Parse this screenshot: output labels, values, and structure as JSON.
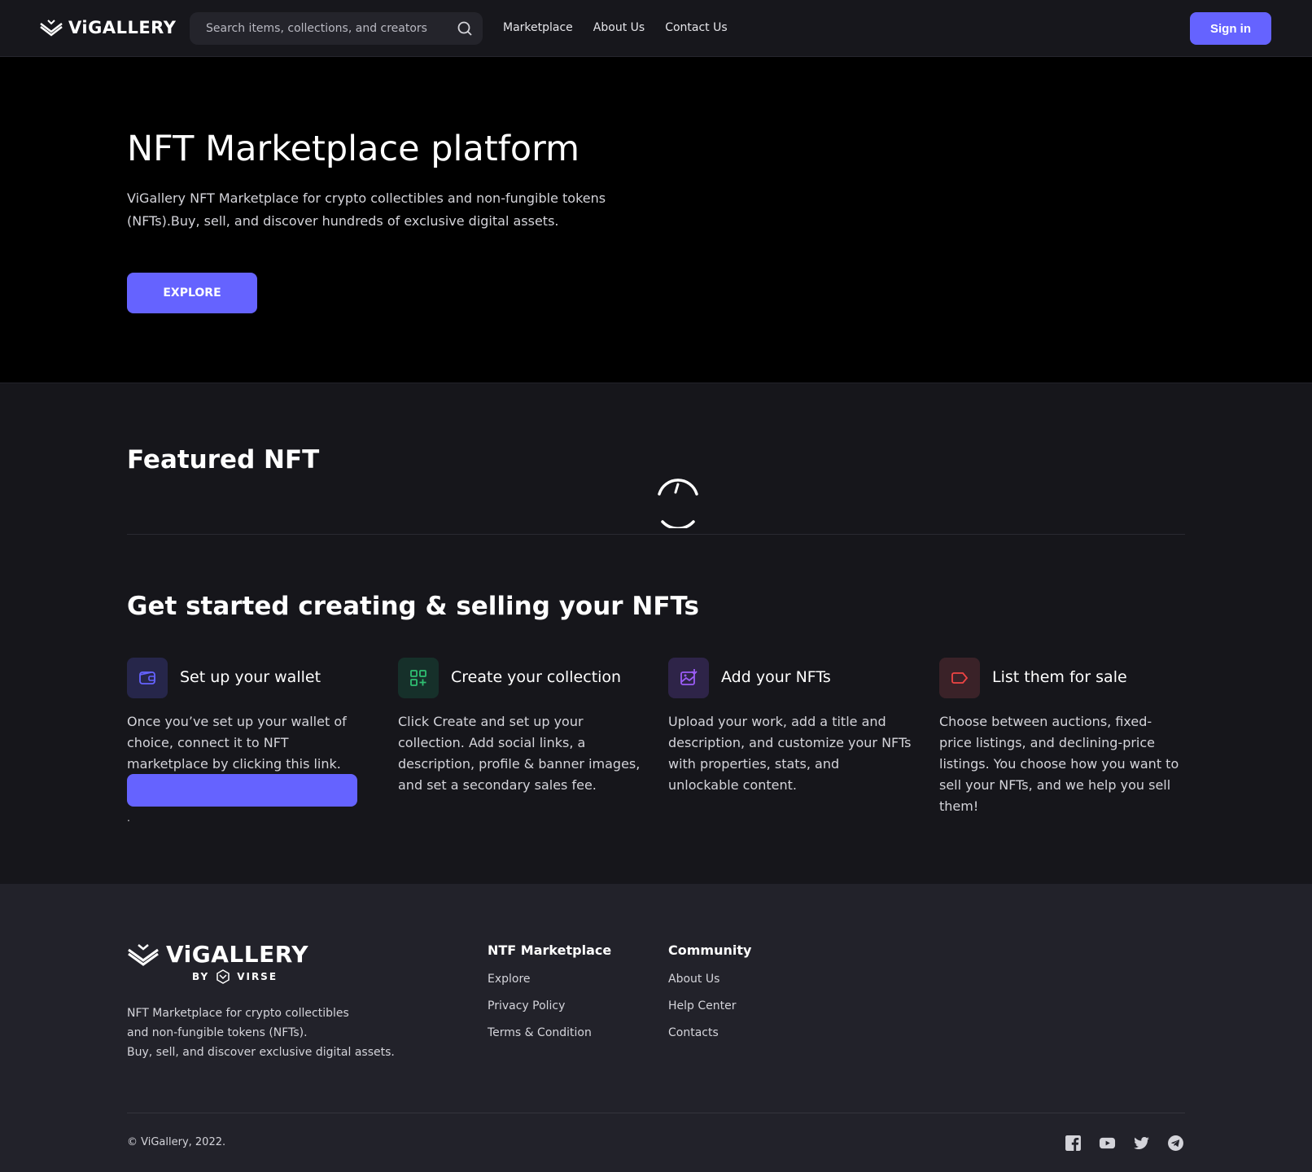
{
  "header": {
    "logo_text": "ViGALLERY",
    "search_placeholder": "Search items, collections, and creators",
    "nav": [
      "Marketplace",
      "About Us",
      "Contact Us"
    ],
    "signin_label": "Sign in"
  },
  "hero": {
    "title": "NFT Marketplace platform",
    "description": "ViGallery NFT Marketplace for crypto collectibles and non-fungible tokens (NFTs).Buy, sell, and discover hundreds of exclusive digital assets.",
    "cta_label": "EXPLORE"
  },
  "featured": {
    "title": "Featured NFT"
  },
  "get_started": {
    "title": "Get started creating & selling your NFTs",
    "steps": [
      {
        "title": "Set up your wallet",
        "description": "Once you’ve set up your wallet of choice, connect it to NFT marketplace by clicking this link.",
        "icon": "wallet-icon",
        "icon_color": "#6563ff",
        "icon_bg": "#26264a"
      },
      {
        "title": "Create your collection",
        "description": "Click Create and set up your collection. Add social links, a description, profile & banner images, and set a secondary sales fee.",
        "icon": "grid-plus-icon",
        "icon_color": "#2fbf71",
        "icon_bg": "#16302a"
      },
      {
        "title": "Add your NFTs",
        "description": "Upload your work, add a title and description, and customize your NFTs with properties, stats, and unlockable content.",
        "icon": "image-add-icon",
        "icon_color": "#9b5cf6",
        "icon_bg": "#2e2448"
      },
      {
        "title": "List them for sale",
        "description": "Choose between auctions, fixed-price listings, and declining-price listings. You choose how you want to sell your NFTs, and we help you sell them!",
        "icon": "tag-icon",
        "icon_color": "#ef4444",
        "icon_bg": "#3a2228"
      }
    ],
    "trailing_dot": "."
  },
  "footer": {
    "logo_text": "ViGALLERY",
    "by_text": "BY",
    "brand_text": "VIRSE",
    "description_lines": [
      "NFT Marketplace for crypto collectibles",
      "and non-fungible tokens (NFTs).",
      "Buy, sell, and discover exclusive digital assets."
    ],
    "columns": [
      {
        "title": "NTF Marketplace",
        "links": [
          "Explore",
          "Privacy Policy",
          "Terms & Condition"
        ]
      },
      {
        "title": "Community",
        "links": [
          "About Us",
          "Help Center",
          "Contacts"
        ]
      }
    ],
    "copyright": "© ViGallery, 2022.",
    "socials": [
      "facebook-icon",
      "youtube-icon",
      "twitter-icon",
      "telegram-icon"
    ]
  },
  "colors": {
    "accent": "#6563ff",
    "header_bg": "#17171c",
    "hero_bg": "#000000",
    "main_bg": "#16161b",
    "footer_bg": "#22222a"
  }
}
